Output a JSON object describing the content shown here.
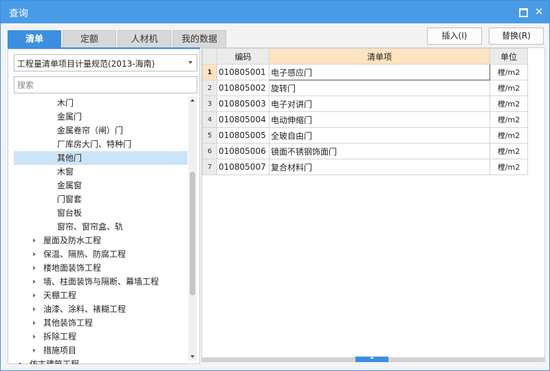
{
  "window": {
    "title": "查询",
    "close_glyph": "✕"
  },
  "tabs": [
    "清单",
    "定额",
    "人材机",
    "我的数据"
  ],
  "actions": {
    "insert": "插入(I)",
    "replace": "替换(R)"
  },
  "standard_select": {
    "value": "工程量清单项目计量规范(2013-海南)"
  },
  "search": {
    "placeholder": "搜索"
  },
  "tree": {
    "items": [
      {
        "label": "木门",
        "level": 2,
        "expandable": false,
        "selected": false
      },
      {
        "label": "金属门",
        "level": 2,
        "expandable": false,
        "selected": false
      },
      {
        "label": "金属卷帘（闸）门",
        "level": 2,
        "expandable": false,
        "selected": false
      },
      {
        "label": "厂库房大门、特种门",
        "level": 2,
        "expandable": false,
        "selected": false
      },
      {
        "label": "其他门",
        "level": 2,
        "expandable": false,
        "selected": true
      },
      {
        "label": "木窗",
        "level": 2,
        "expandable": false,
        "selected": false
      },
      {
        "label": "金属窗",
        "level": 2,
        "expandable": false,
        "selected": false
      },
      {
        "label": "门窗套",
        "level": 2,
        "expandable": false,
        "selected": false
      },
      {
        "label": "窗台板",
        "level": 2,
        "expandable": false,
        "selected": false
      },
      {
        "label": "窗帘、窗帘盒、轨",
        "level": 2,
        "expandable": false,
        "selected": false
      },
      {
        "label": "屋面及防水工程",
        "level": 1,
        "expandable": true,
        "selected": false
      },
      {
        "label": "保温、隔热、防腐工程",
        "level": 1,
        "expandable": true,
        "selected": false
      },
      {
        "label": "楼地面装饰工程",
        "level": 1,
        "expandable": true,
        "selected": false
      },
      {
        "label": "墙、柱面装饰与隔断、幕墙工程",
        "level": 1,
        "expandable": true,
        "selected": false
      },
      {
        "label": "天棚工程",
        "level": 1,
        "expandable": true,
        "selected": false
      },
      {
        "label": "油漆、涂料、裱糊工程",
        "level": 1,
        "expandable": true,
        "selected": false
      },
      {
        "label": "其他装饰工程",
        "level": 1,
        "expandable": true,
        "selected": false
      },
      {
        "label": "拆除工程",
        "level": 1,
        "expandable": true,
        "selected": false
      },
      {
        "label": "措施项目",
        "level": 1,
        "expandable": true,
        "selected": false
      },
      {
        "label": "仿古建筑工程",
        "level": 0,
        "expandable": true,
        "selected": false
      }
    ]
  },
  "table": {
    "columns": [
      "编码",
      "清单项",
      "单位"
    ],
    "current_row": 1,
    "rows": [
      {
        "no": "1",
        "code": "010805001",
        "item": "电子感应门",
        "unit": "樘/m2"
      },
      {
        "no": "2",
        "code": "010805002",
        "item": "旋转门",
        "unit": "樘/m2"
      },
      {
        "no": "3",
        "code": "010805003",
        "item": "电子对讲门",
        "unit": "樘/m2"
      },
      {
        "no": "4",
        "code": "010805004",
        "item": "电动伸缩门",
        "unit": "樘/m2"
      },
      {
        "no": "5",
        "code": "010805005",
        "item": "全玻自由门",
        "unit": "樘/m2"
      },
      {
        "no": "6",
        "code": "010805006",
        "item": "镜面不锈钢饰面门",
        "unit": "樘/m2"
      },
      {
        "no": "7",
        "code": "010805007",
        "item": "复合材料门",
        "unit": "樘/m2"
      }
    ]
  },
  "colors": {
    "accent": "#3c8fe0",
    "title_bar": "#4a9be6",
    "selection": "#cce4f7",
    "header_highlight": "#fde3bf"
  }
}
